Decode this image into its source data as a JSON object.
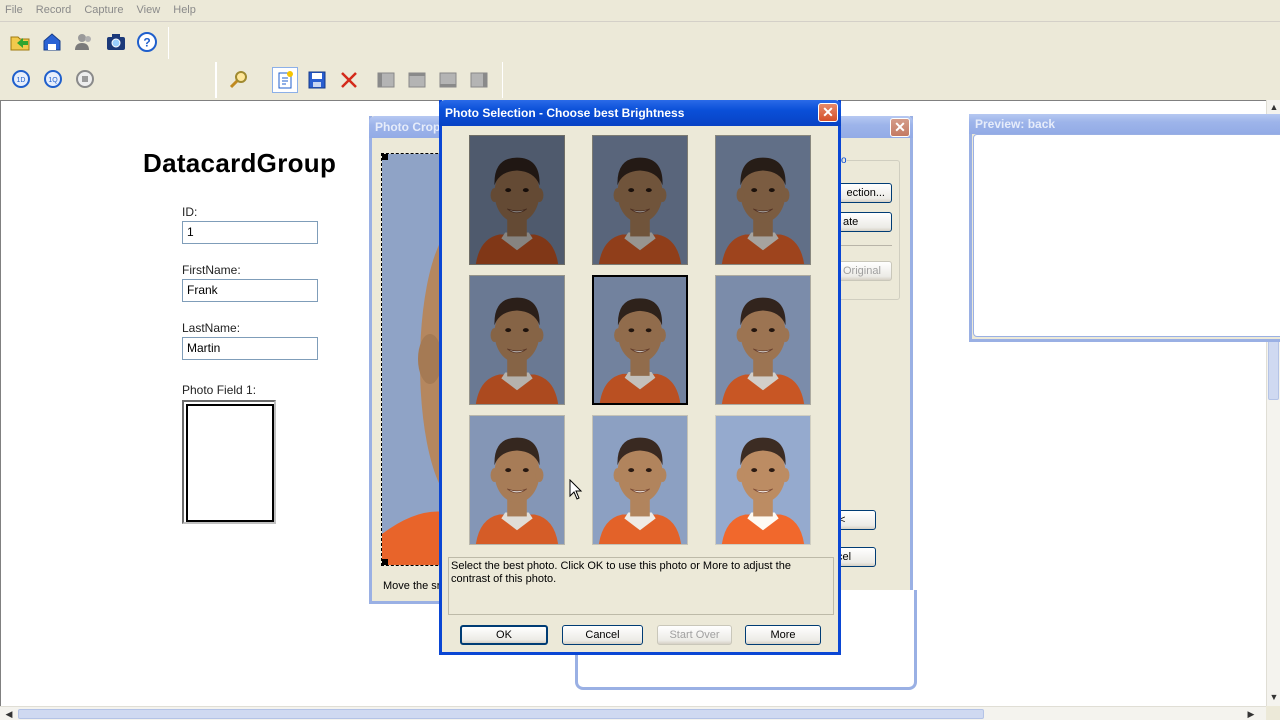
{
  "menu": [
    "File",
    "Record",
    "Capture",
    "View",
    "Help"
  ],
  "toolbar1": [
    {
      "name": "open-folder-icon",
      "glyph": "folder"
    },
    {
      "name": "import-icon",
      "glyph": "import"
    },
    {
      "name": "users-icon",
      "glyph": "users"
    },
    {
      "name": "camera-icon",
      "glyph": "camera"
    },
    {
      "name": "help-icon",
      "glyph": "?"
    }
  ],
  "toolbar2": [
    {
      "name": "first-record-icon"
    },
    {
      "name": "previous-record-icon"
    },
    {
      "name": "refresh-icon"
    }
  ],
  "toolbar3": [
    {
      "name": "search-icon"
    },
    {
      "name": "new-record-icon"
    },
    {
      "name": "save-icon"
    },
    {
      "name": "delete-icon"
    },
    {
      "name": "nav-first-icon"
    },
    {
      "name": "nav-prev-icon"
    },
    {
      "name": "nav-next-icon"
    },
    {
      "name": "nav-last-icon"
    }
  ],
  "form": {
    "brand": "DatacardGroup",
    "id_label": "ID:",
    "id_value": "1",
    "first_label": "FirstName:",
    "first_value": "Frank",
    "last_label": "LastName:",
    "last_value": "Martin",
    "photo_label": "Photo Field 1:"
  },
  "crop_window": {
    "title": "Photo Crop",
    "hint": "Move the sr",
    "btn_selection": "ection...",
    "btn_rotate": "ate",
    "btn_original": "Original",
    "btn_ok": "<",
    "btn_cancel": "cel"
  },
  "preview_window": {
    "title": "Preview: back"
  },
  "selection_dialog": {
    "title": "Photo Selection - Choose best Brightness",
    "instruction": "Select the best photo. Click OK to use this photo or More to adjust the contrast of this photo.",
    "buttons": {
      "ok": "OK",
      "cancel": "Cancel",
      "start_over": "Start Over",
      "more": "More"
    },
    "selected_index": 4,
    "brightness_levels": [
      0.55,
      0.62,
      0.68,
      0.74,
      0.8,
      0.86,
      0.92,
      0.98,
      1.04
    ]
  },
  "colors": {
    "title_active": "#0a4fd8",
    "title_inactive": "#9db4ea",
    "photo_bg": "#8fa3c6",
    "skin": "#b5875f",
    "hair": "#3a2a22",
    "shirt": "#e8642a"
  }
}
